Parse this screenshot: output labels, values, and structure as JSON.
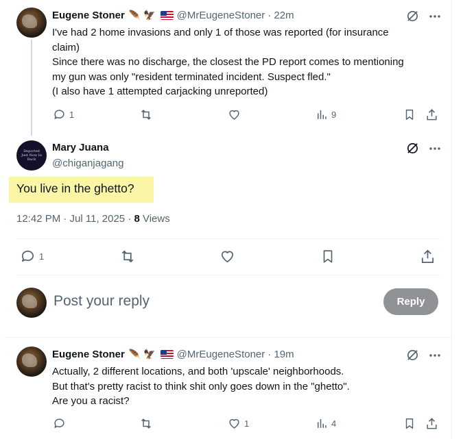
{
  "tweet1": {
    "name": "Eugene Stoner",
    "badges": "🪶 🦅",
    "handle": "@MrEugeneStoner",
    "time": "· 22m",
    "lines": [
      "I've had 2 home invasions and only 1 of those was reported (for insurance",
      "claim)",
      "Since there was no discharge, the closest the PD report comes to mentioning",
      "my gun was only \"resident terminated incident. Suspect fled.\"",
      "(I also have 1 attempted carjacking unreported)"
    ],
    "replies": "1",
    "views": "9"
  },
  "main": {
    "name": "Mary Juana",
    "handle": "@chiganjagang",
    "avatar_text": "Deported Just Now In Back",
    "text": "You live in the ghetto?",
    "time": "12:42 PM · Jul 11, 2025 · ",
    "views_count": "8",
    "views_label": " Views",
    "replies": "1"
  },
  "composer": {
    "placeholder": "Post your reply",
    "button": "Reply"
  },
  "tweet2": {
    "name": "Eugene Stoner",
    "badges": "🪶 🦅",
    "handle": "@MrEugeneStoner",
    "time": "· 19m",
    "lines": [
      "Actually, 2 different locations, and both 'upscale' neighborhoods.",
      "But that's pretty racist to think shit only goes down in the \"ghetto\".",
      "Are you a racist?"
    ],
    "likes": "1",
    "views": "4"
  },
  "colors": {
    "highlight": "#faf6a6",
    "muted": "#536471",
    "reply_button": "#8f9396"
  }
}
